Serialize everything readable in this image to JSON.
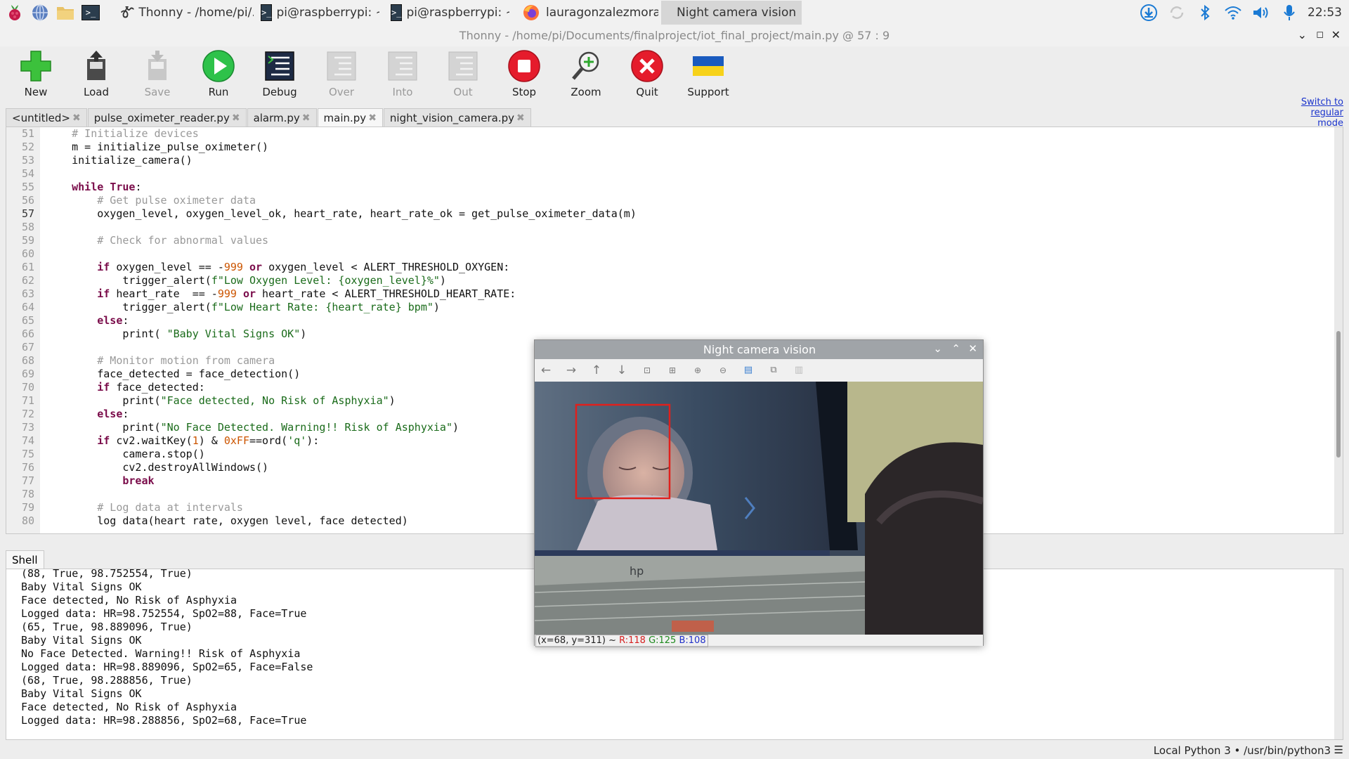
{
  "taskbar": {
    "icons": [
      "raspberry-menu-icon",
      "browser-globe-icon",
      "file-manager-icon",
      "terminal-icon"
    ],
    "tasks": [
      {
        "label": "Thonny  -  /home/pi/..",
        "icon": "thonny-icon"
      },
      {
        "label": "pi@raspberrypi: ~",
        "icon": "terminal-icon"
      },
      {
        "label": "pi@raspberrypi: ~",
        "icon": "terminal-icon"
      },
      {
        "label": "lauragonzalezmoran..",
        "icon": "firefox-icon"
      },
      {
        "label": "Night camera vision",
        "icon": ""
      }
    ],
    "tray": [
      "update-download-icon",
      "sync-icon",
      "bluetooth-icon",
      "wifi-icon",
      "volume-icon",
      "microphone-icon"
    ],
    "clock": "22:53"
  },
  "window": {
    "title": "Thonny  -  /home/pi/Documents/finalproject/iot_final_project/main.py  @  57 : 9",
    "buttons": [
      "minimize",
      "maximize",
      "close"
    ]
  },
  "toolbar": {
    "buttons": [
      {
        "label": "New",
        "enabled": true
      },
      {
        "label": "Load",
        "enabled": true
      },
      {
        "label": "Save",
        "enabled": false
      },
      {
        "label": "Run",
        "enabled": true
      },
      {
        "label": "Debug",
        "enabled": true
      },
      {
        "label": "Over",
        "enabled": false
      },
      {
        "label": "Into",
        "enabled": false
      },
      {
        "label": "Out",
        "enabled": false
      },
      {
        "label": "Stop",
        "enabled": true
      },
      {
        "label": "Zoom",
        "enabled": true
      },
      {
        "label": "Quit",
        "enabled": true
      },
      {
        "label": "Support",
        "enabled": true
      }
    ],
    "switch_mode_link": [
      "Switch to",
      "regular",
      "mode"
    ]
  },
  "tabs": [
    {
      "label": "<untitled>",
      "active": false
    },
    {
      "label": "pulse_oximeter_reader.py",
      "active": false
    },
    {
      "label": "alarm.py",
      "active": false
    },
    {
      "label": "main.py",
      "active": true
    },
    {
      "label": "night_vision_camera.py",
      "active": false
    }
  ],
  "tab_close_glyph": "✖",
  "editor": {
    "current_line": "57",
    "line_numbers": [
      "51",
      "52",
      "53",
      "54",
      "55",
      "56",
      "57",
      "58",
      "59",
      "60",
      "61",
      "62",
      "63",
      "64",
      "65",
      "66",
      "67",
      "68",
      "69",
      "70",
      "71",
      "72",
      "73",
      "74",
      "75",
      "76",
      "77",
      "78",
      "79",
      "80"
    ],
    "code_lines": [
      [
        {
          "t": "    "
        },
        {
          "t": "# Initialize devices",
          "c": "cm"
        }
      ],
      [
        {
          "t": "    m = initialize_pulse_oximeter()"
        }
      ],
      [
        {
          "t": "    initialize_camera()"
        }
      ],
      [
        {
          "t": ""
        }
      ],
      [
        {
          "t": "    "
        },
        {
          "t": "while",
          "c": "kw"
        },
        {
          "t": " "
        },
        {
          "t": "True",
          "c": "kw"
        },
        {
          "t": ":"
        }
      ],
      [
        {
          "t": "        "
        },
        {
          "t": "# Get pulse oximeter data",
          "c": "cm"
        }
      ],
      [
        {
          "t": "        oxygen_level, oxygen_level_ok, heart_rate, heart_rate_ok = get_pulse_oximeter_data(m)"
        }
      ],
      [
        {
          "t": ""
        }
      ],
      [
        {
          "t": "        "
        },
        {
          "t": "# Check for abnormal values",
          "c": "cm"
        }
      ],
      [
        {
          "t": ""
        }
      ],
      [
        {
          "t": "        "
        },
        {
          "t": "if",
          "c": "kw"
        },
        {
          "t": " oxygen_level == -"
        },
        {
          "t": "999",
          "c": "nm"
        },
        {
          "t": " "
        },
        {
          "t": "or",
          "c": "kw"
        },
        {
          "t": " oxygen_level < ALERT_THRESHOLD_OXYGEN:"
        }
      ],
      [
        {
          "t": "            trigger_alert("
        },
        {
          "t": "f\"Low Oxygen Level: {oxygen_level}%\"",
          "c": "st"
        },
        {
          "t": ")"
        }
      ],
      [
        {
          "t": "        "
        },
        {
          "t": "if",
          "c": "kw"
        },
        {
          "t": " heart_rate  == -"
        },
        {
          "t": "999",
          "c": "nm"
        },
        {
          "t": " "
        },
        {
          "t": "or",
          "c": "kw"
        },
        {
          "t": " heart_rate < ALERT_THRESHOLD_HEART_RATE:"
        }
      ],
      [
        {
          "t": "            trigger_alert("
        },
        {
          "t": "f\"Low Heart Rate: {heart_rate} bpm\"",
          "c": "st"
        },
        {
          "t": ")"
        }
      ],
      [
        {
          "t": "        "
        },
        {
          "t": "else",
          "c": "kw"
        },
        {
          "t": ":"
        }
      ],
      [
        {
          "t": "            print( "
        },
        {
          "t": "\"Baby Vital Signs OK\"",
          "c": "st"
        },
        {
          "t": ")"
        }
      ],
      [
        {
          "t": ""
        }
      ],
      [
        {
          "t": "        "
        },
        {
          "t": "# Monitor motion from camera",
          "c": "cm"
        }
      ],
      [
        {
          "t": "        face_detected = face_detection()"
        }
      ],
      [
        {
          "t": "        "
        },
        {
          "t": "if",
          "c": "kw"
        },
        {
          "t": " face_detected:"
        }
      ],
      [
        {
          "t": "            print("
        },
        {
          "t": "\"Face detected, No Risk of Asphyxia\"",
          "c": "st"
        },
        {
          "t": ")"
        }
      ],
      [
        {
          "t": "        "
        },
        {
          "t": "else",
          "c": "kw"
        },
        {
          "t": ":"
        }
      ],
      [
        {
          "t": "            print("
        },
        {
          "t": "\"No Face Detected. Warning!! Risk of Asphyxia\"",
          "c": "st"
        },
        {
          "t": ")"
        }
      ],
      [
        {
          "t": "        "
        },
        {
          "t": "if",
          "c": "kw"
        },
        {
          "t": " cv2.waitKey("
        },
        {
          "t": "1",
          "c": "nm"
        },
        {
          "t": ") & "
        },
        {
          "t": "0xFF",
          "c": "nm"
        },
        {
          "t": "==ord("
        },
        {
          "t": "'q'",
          "c": "st"
        },
        {
          "t": "):"
        }
      ],
      [
        {
          "t": "            camera.stop()"
        }
      ],
      [
        {
          "t": "            cv2.destroyAllWindows()"
        }
      ],
      [
        {
          "t": "            "
        },
        {
          "t": "break",
          "c": "kw"
        }
      ],
      [
        {
          "t": ""
        }
      ],
      [
        {
          "t": "        "
        },
        {
          "t": "# Log data at intervals",
          "c": "cm"
        }
      ],
      [
        {
          "t": "        log data(heart rate, oxygen level, face detected)"
        }
      ]
    ]
  },
  "shell": {
    "tab_label": "Shell",
    "lines": [
      "(88, True, 98.752554, True)",
      "Baby Vital Signs OK",
      "Face detected, No Risk of Asphyxia",
      "Logged data: HR=98.752554, SpO2=88, Face=True",
      "(65, True, 98.889096, True)",
      "Baby Vital Signs OK",
      "No Face Detected. Warning!! Risk of Asphyxia",
      "Logged data: HR=98.889096, SpO2=65, Face=False",
      "(68, True, 98.288856, True)",
      "Baby Vital Signs OK",
      "Face detected, No Risk of Asphyxia",
      "Logged data: HR=98.288856, SpO2=68, Face=True"
    ]
  },
  "statusbar": {
    "interpreter": "Local Python 3  •  /usr/bin/python3",
    "menu_glyph": "☰"
  },
  "camera_window": {
    "title": "Night camera vision",
    "controls": [
      "minimize",
      "maximize",
      "close"
    ],
    "toolbar": [
      "pan-left-icon",
      "pan-right-icon",
      "pan-up-icon",
      "pan-down-icon",
      "zoom-in-icon",
      "zoom-fit-icon",
      "zoom-out-icon",
      "zoom-reset-icon",
      "save-image-icon",
      "copy-image-icon",
      "properties-icon"
    ],
    "status_coords": "(x=68, y=311) ~ ",
    "status_r": "R:118",
    "status_g": "G:125",
    "status_b": "B:108",
    "status_colors": {
      "r": "#d62020",
      "g": "#1e8a1e",
      "b": "#2030c8"
    },
    "face_box_color": "#e0201c"
  }
}
